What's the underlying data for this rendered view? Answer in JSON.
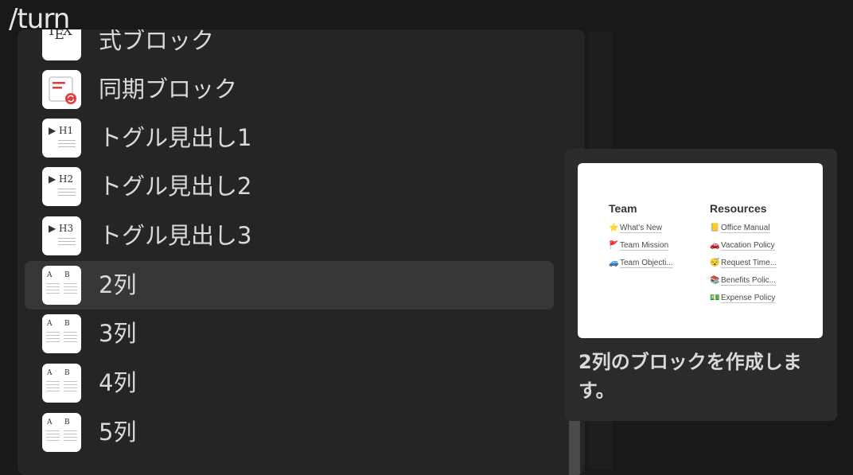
{
  "editor": {
    "input_text": "/turn"
  },
  "menu": {
    "items": [
      {
        "label": "式ブロック",
        "thumb": "tex-icon"
      },
      {
        "label": "同期ブロック",
        "thumb": "synced-block-icon"
      },
      {
        "label": "トグル見出し1",
        "thumb": "toggle-heading-1-icon",
        "thumb_text": "▶ H1"
      },
      {
        "label": "トグル見出し2",
        "thumb": "toggle-heading-2-icon",
        "thumb_text": "▶ H2"
      },
      {
        "label": "トグル見出し3",
        "thumb": "toggle-heading-3-icon",
        "thumb_text": "▶ H3"
      },
      {
        "label": "2列",
        "thumb": "columns-icon",
        "selected": true
      },
      {
        "label": "3列",
        "thumb": "columns-icon"
      },
      {
        "label": "4列",
        "thumb": "columns-icon"
      },
      {
        "label": "5列",
        "thumb": "columns-icon"
      }
    ],
    "tex_logo": {
      "t": "T",
      "e": "E",
      "x": "X"
    },
    "column_letters": {
      "a": "A",
      "b": "B"
    }
  },
  "preview": {
    "left_column": {
      "heading": "Team",
      "rows": [
        {
          "icon": "⭐",
          "text": "What's New"
        },
        {
          "icon": "🚩",
          "text": "Team Mission"
        },
        {
          "icon": "🚙",
          "text": "Team Objecti..."
        }
      ]
    },
    "right_column": {
      "heading": "Resources",
      "rows": [
        {
          "icon": "📒",
          "text": "Office Manual"
        },
        {
          "icon": "🚗",
          "text": "Vacation Policy"
        },
        {
          "icon": "😴",
          "text": "Request Time..."
        },
        {
          "icon": "📚",
          "text": "Benefits Polic..."
        },
        {
          "icon": "💵",
          "text": "Expense Policy"
        }
      ]
    },
    "description": "2列のブロックを作成します。"
  },
  "colors": {
    "background": "#191919",
    "menu_bg": "#252525",
    "selected_bg": "#373737",
    "panel_bg": "#2b2b2b",
    "synced_accent": "#e03e3e"
  }
}
